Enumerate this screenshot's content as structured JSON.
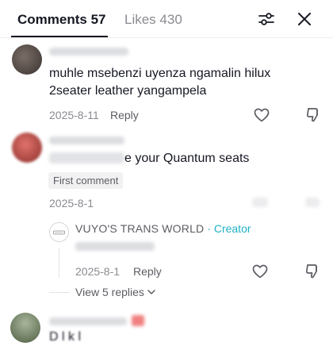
{
  "tabs": {
    "comments_label": "Comments 57",
    "likes_label": "Likes 430"
  },
  "header": {
    "filter_icon": "sliders-icon",
    "close_icon": "close-icon"
  },
  "comments": [
    {
      "text_line1": "muhle msebenzi uyenza ngamalin hilux",
      "text_line2": "2seater leather yangampela",
      "date": "2025-8-11",
      "reply_label": "Reply"
    },
    {
      "text": "e your Quantum seats",
      "badge": "First comment",
      "date": "2025-8-1"
    }
  ],
  "creator_reply": {
    "name": "VUYO'S TRANS WORLD",
    "separator": " · ",
    "badge": "Creator",
    "date": "2025-8-1",
    "reply_label": "Reply"
  },
  "view_replies": {
    "label": "View 5 replies"
  },
  "next_comment": {
    "partial_text": "D l k l"
  },
  "colors": {
    "creator_accent": "#20b2c6",
    "muted_text": "#8a8b91"
  }
}
